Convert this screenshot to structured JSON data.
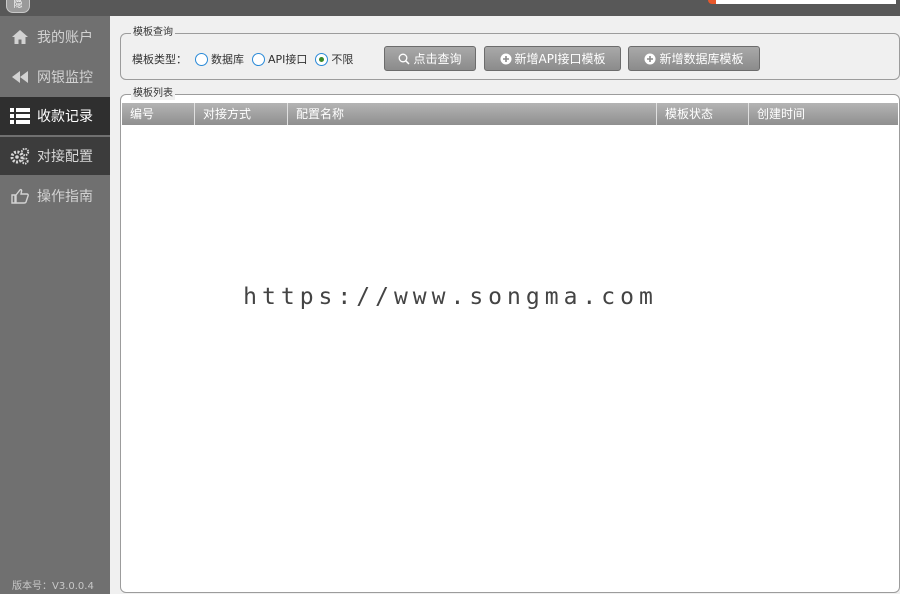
{
  "topbar": {
    "hide_label": "隐"
  },
  "sidebar": {
    "items": [
      {
        "label": "我的账户",
        "icon": "home-icon"
      },
      {
        "label": "网银监控",
        "icon": "rewind-icon"
      },
      {
        "label": "收款记录",
        "icon": "list-icon"
      },
      {
        "label": "对接配置",
        "icon": "gears-icon"
      },
      {
        "label": "操作指南",
        "icon": "hand-pointing-icon"
      }
    ],
    "version": "版本号：V3.0.0.4"
  },
  "query": {
    "legend": "模板查询",
    "type_label": "模板类型：",
    "options": [
      "数据库",
      "API接口",
      "不限"
    ],
    "selected": "不限",
    "buttons": {
      "search": "点击查询",
      "add_api": "新增API接口模板",
      "add_db": "新增数据库模板"
    }
  },
  "list": {
    "legend": "模板列表",
    "columns": [
      "编号",
      "对接方式",
      "配置名称",
      "模板状态",
      "创建时间"
    ],
    "rows": []
  },
  "watermark": "https://www.songma.com",
  "colors": {
    "sidebar_bg": "#707070",
    "sidebar_active": "#2f2f2f",
    "radio_border": "#2a8ad8",
    "radio_dot": "#3a8a2a",
    "brand_accent": "#e8582b"
  }
}
